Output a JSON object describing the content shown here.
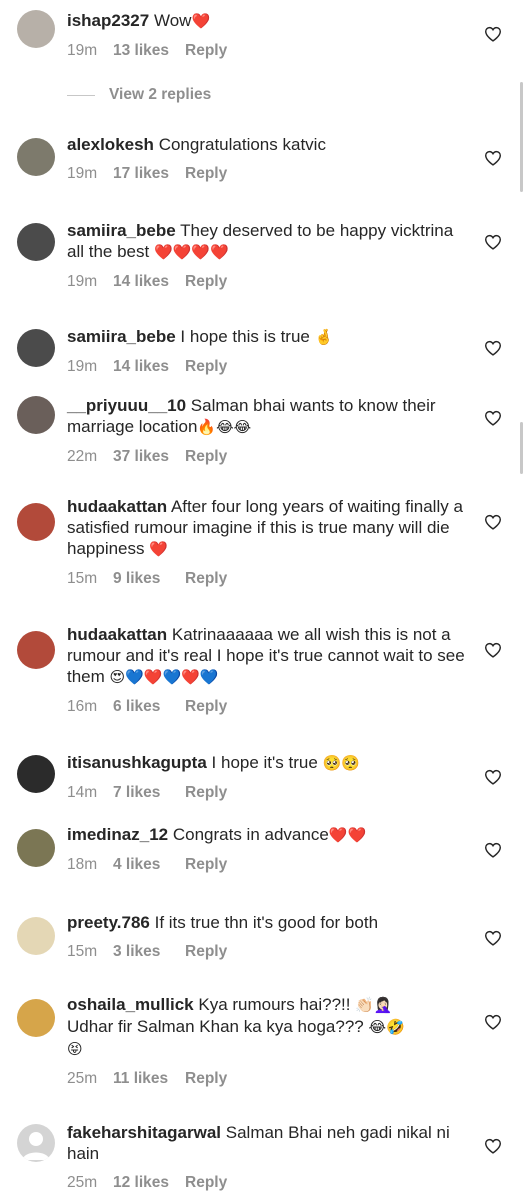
{
  "comments": [
    {
      "user": "ishap2327",
      "text": "Wow",
      "emoji": "❤️",
      "time": "19m",
      "likes": "13 likes",
      "reply": "Reply",
      "avatar_color": "#b7b0a8"
    },
    {
      "user": "alexlokesh",
      "text": "Congratulations katvic",
      "emoji": "",
      "time": "19m",
      "likes": "17 likes",
      "reply": "Reply",
      "avatar_color": "#7d7a6c"
    },
    {
      "user": "samiira_bebe",
      "text": "They deserved to be happy vicktrina all the best",
      "emoji": "❤️❤️❤️❤️",
      "time": "19m",
      "likes": "14 likes",
      "reply": "Reply",
      "avatar_color": "#4b4b4b"
    },
    {
      "user": "samiira_bebe",
      "text": "I hope this is true",
      "emoji": "🤞",
      "time": "19m",
      "likes": "14 likes",
      "reply": "Reply",
      "avatar_color": "#4b4b4b"
    },
    {
      "user": "__priyuuu__10",
      "text": "Salman bhai wants to know their marriage location",
      "emoji": "🔥😂😂",
      "time": "22m",
      "likes": "37 likes",
      "reply": "Reply",
      "avatar_color": "#6a5f5a"
    },
    {
      "user": "hudaakattan",
      "text": "After four long years of waiting finally a satisfied rumour imagine if this is true many will die happiness",
      "emoji": "❤️",
      "time": "15m",
      "likes": "9 likes",
      "reply": "Reply",
      "avatar_color": "#b24a3a"
    },
    {
      "user": "hudaakattan",
      "text": "Katrinaaaaaa we all wish this is not a rumour and it's real I hope it's true cannot wait to see them",
      "emoji": "😍💙❤️💙❤️💙",
      "time": "16m",
      "likes": "6 likes",
      "reply": "Reply",
      "avatar_color": "#b24a3a"
    },
    {
      "user": "itisanushkagupta",
      "text": "I hope it's true",
      "emoji": "🥺🥺",
      "time": "14m",
      "likes": "7 likes",
      "reply": "Reply",
      "avatar_color": "#2b2b2b"
    },
    {
      "user": "imedinaz_12",
      "text": "Congrats in advance",
      "emoji": "❤️❤️",
      "time": "18m",
      "likes": "4 likes",
      "reply": "Reply",
      "avatar_color": "#7b7654"
    },
    {
      "user": "preety.786",
      "text": "If its true thn it's good for both",
      "emoji": "",
      "time": "15m",
      "likes": "3 likes",
      "reply": "Reply",
      "avatar_color": "#e4d7b5"
    },
    {
      "user": "oshaila_mullick",
      "text": "Kya rumours hai??!!",
      "text2": "Udhar fir Salman Khan ka kya hoga???",
      "emoji": "👏🏻🤦🏻‍♀️",
      "emoji2": "😂🤣",
      "emoji3": "😝",
      "time": "25m",
      "likes": "11 likes",
      "reply": "Reply",
      "avatar_color": "#d6a54a"
    },
    {
      "user": "fakeharshitagarwal",
      "text": "Salman Bhai neh gadi nikal ni hain",
      "emoji": "",
      "time": "25m",
      "likes": "12 likes",
      "reply": "Reply",
      "avatar_color": "#d4d4d4"
    }
  ],
  "view_replies": "View 2 replies"
}
